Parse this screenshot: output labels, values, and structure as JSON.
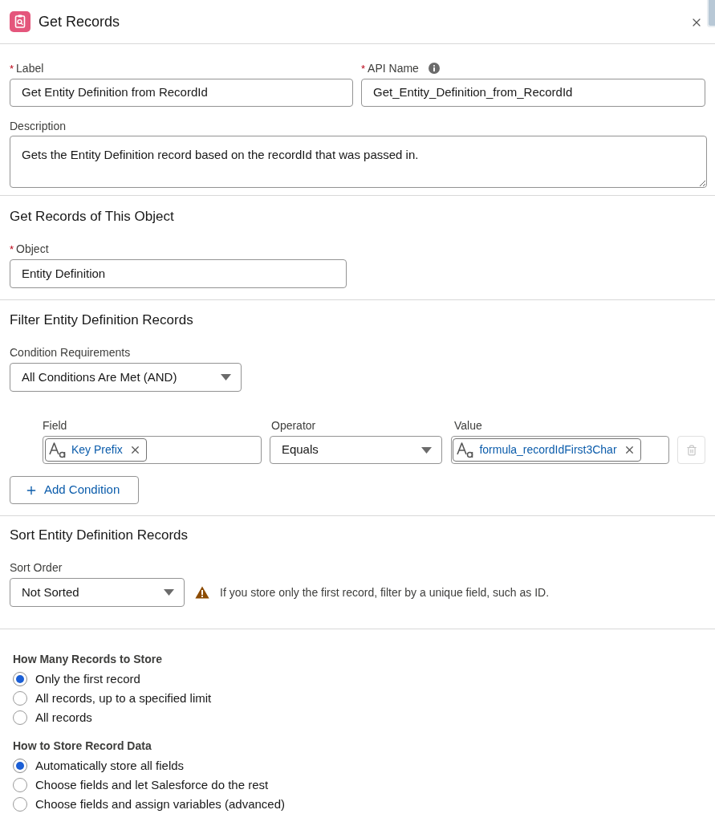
{
  "header": {
    "title": "Get Records"
  },
  "details": {
    "label": {
      "label": "Label",
      "required_mark": "*",
      "value": "Get Entity Definition from RecordId"
    },
    "api_name": {
      "label": "API Name",
      "required_mark": "*",
      "value": "Get_Entity_Definition_from_RecordId"
    },
    "description": {
      "label": "Description",
      "value": "Gets the Entity Definition record based on the recordId that was passed in."
    }
  },
  "object_section": {
    "title": "Get Records of This Object",
    "object": {
      "label": "Object",
      "required_mark": "*",
      "value": "Entity Definition"
    }
  },
  "filter_section": {
    "title": "Filter Entity Definition Records",
    "condition_requirements": {
      "label": "Condition Requirements",
      "value": "All Conditions Are Met (AND)"
    },
    "columns": [
      "Field",
      "Operator",
      "Value"
    ],
    "conditions": [
      {
        "field": "Key Prefix",
        "operator": "Equals",
        "value": "formula_recordIdFirst3Char",
        "delete_disabled": true
      }
    ],
    "add_button": "Add Condition"
  },
  "sort_section": {
    "title": "Sort Entity Definition Records",
    "sort_order": {
      "label": "Sort Order",
      "value": "Not Sorted"
    },
    "warning": "If you store only the first record, filter by a unique field, such as ID."
  },
  "store_options": [
    {
      "title": "How Many Records to Store",
      "options": [
        {
          "label": "Only the first record",
          "selected": true
        },
        {
          "label": "All records, up to a specified limit",
          "selected": false
        },
        {
          "label": "All records",
          "selected": false
        }
      ]
    },
    {
      "title": "How to Store Record Data",
      "options": [
        {
          "label": "Automatically store all fields",
          "selected": true
        },
        {
          "label": "Choose fields and let Salesforce do the rest",
          "selected": false
        },
        {
          "label": "Choose fields and assign variables (advanced)",
          "selected": false
        }
      ]
    }
  ]
}
